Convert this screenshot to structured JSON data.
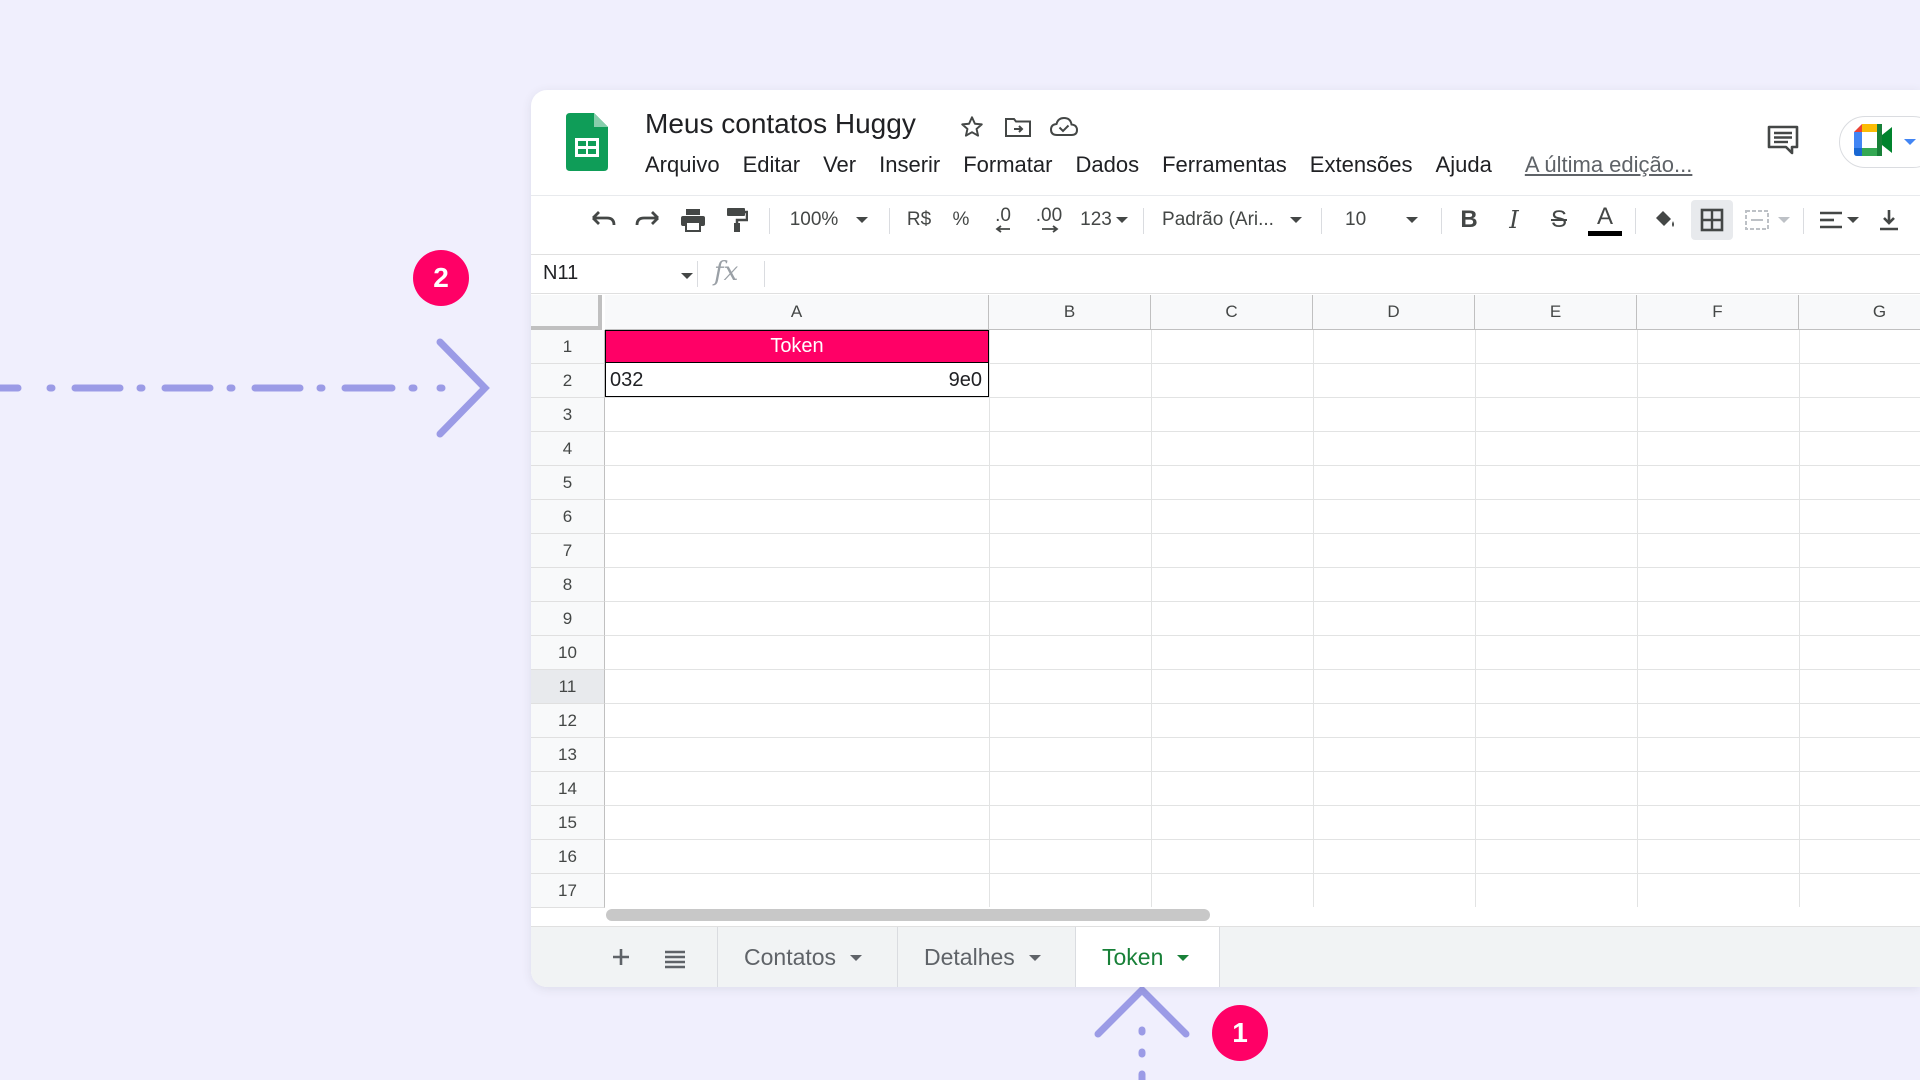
{
  "document": {
    "title": "Meus contatos Huggy",
    "menu": [
      "Arquivo",
      "Editar",
      "Ver",
      "Inserir",
      "Formatar",
      "Dados",
      "Ferramentas",
      "Extensões",
      "Ajuda"
    ],
    "last_edit": "A última edição..."
  },
  "toolbar": {
    "zoom": "100%",
    "currency": "R$",
    "percent": "%",
    "decrease_decimal": ".0",
    "increase_decimal": ".00",
    "more_formats": "123",
    "font": "Padrão (Ari...",
    "font_size": "10",
    "bold": "B",
    "italic": "I",
    "strikethrough": "S",
    "text_color": "A",
    "text_color_hex": "#000000"
  },
  "formula_bar": {
    "name_box": "N11",
    "fx": "fx",
    "value": ""
  },
  "grid": {
    "columns": [
      "A",
      "B",
      "C",
      "D",
      "E",
      "F",
      "G"
    ],
    "rows": [
      "1",
      "2",
      "3",
      "4",
      "5",
      "6",
      "7",
      "8",
      "9",
      "10",
      "11",
      "12",
      "13",
      "14",
      "15",
      "16",
      "17"
    ],
    "selected_row": "11",
    "header_cell": "Token",
    "header_cell_color": "#ff0066",
    "token_left": "032",
    "token_right": "9e0"
  },
  "sheet_tabs": {
    "tabs": [
      "Contatos",
      "Detalhes",
      "Token"
    ],
    "active": "Token",
    "active_color": "#188038"
  },
  "annotations": {
    "badge_1": "1",
    "badge_2": "2",
    "accent": "#ff0066",
    "arrow_color": "#9b9be6"
  }
}
